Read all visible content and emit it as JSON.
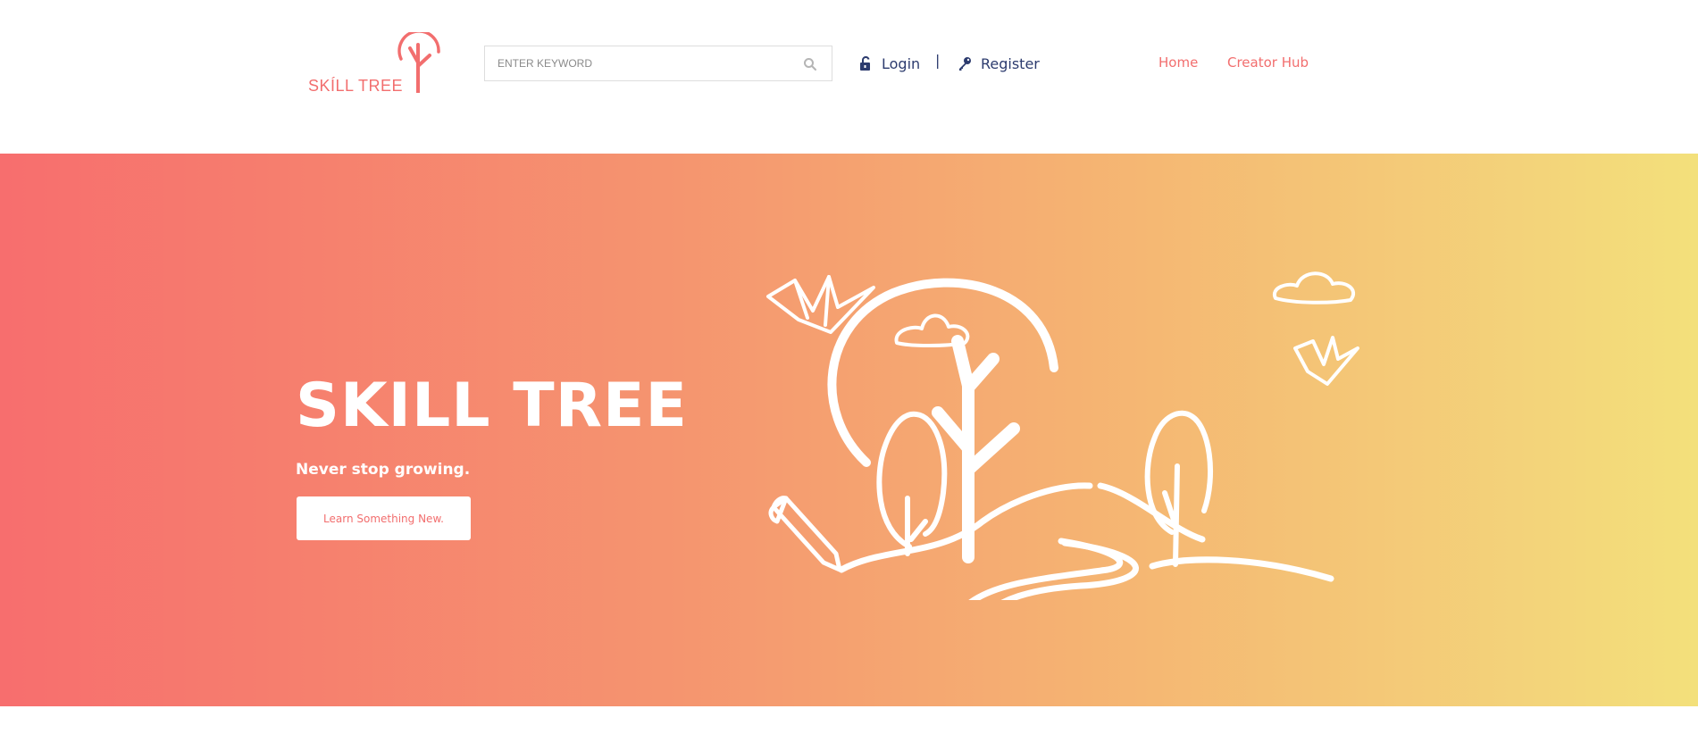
{
  "brand": {
    "logo_text": "SKÍLL TREE",
    "color": "#f26e6e"
  },
  "search": {
    "placeholder": "ENTER KEYWORD",
    "icon": "search-icon"
  },
  "auth": {
    "login_label": "Login",
    "login_icon": "unlock-icon",
    "separator": "|",
    "register_label": "Register",
    "register_icon": "key-icon",
    "color": "#2c3b6e"
  },
  "nav": {
    "items": [
      {
        "label": "Home"
      },
      {
        "label": "Creator Hub"
      }
    ]
  },
  "hero": {
    "title": "SKILL TREE",
    "subtitle": "Never stop growing.",
    "cta_label": "Learn Something New.",
    "gradient_start": "#f76e6e",
    "gradient_end": "#f3e07b"
  }
}
